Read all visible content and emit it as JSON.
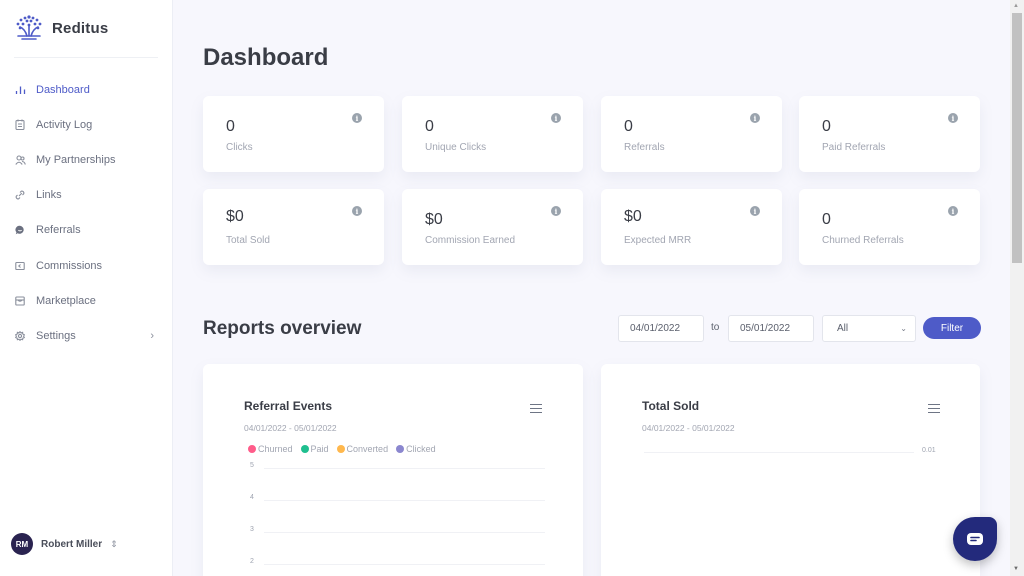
{
  "brand": {
    "name": "Reditus"
  },
  "sidebar": {
    "items": [
      {
        "label": "Dashboard",
        "icon": "bar-chart-icon",
        "active": true
      },
      {
        "label": "Activity Log",
        "icon": "clipboard-icon"
      },
      {
        "label": "My Partnerships",
        "icon": "users-icon"
      },
      {
        "label": "Links",
        "icon": "link-icon"
      },
      {
        "label": "Referrals",
        "icon": "chat-bubble-icon"
      },
      {
        "label": "Commissions",
        "icon": "wallet-icon"
      },
      {
        "label": "Marketplace",
        "icon": "store-icon"
      },
      {
        "label": "Settings",
        "icon": "gear-icon",
        "has_submenu": true
      }
    ],
    "user": {
      "initials": "RM",
      "name": "Robert Miller"
    }
  },
  "page": {
    "title": "Dashboard"
  },
  "stats": [
    {
      "value": "0",
      "label": "Clicks"
    },
    {
      "value": "0",
      "label": "Unique Clicks"
    },
    {
      "value": "0",
      "label": "Referrals"
    },
    {
      "value": "0",
      "label": "Paid Referrals"
    },
    {
      "value": "$0",
      "label": "Total Sold"
    },
    {
      "value": "$0",
      "label": "Commission Earned"
    },
    {
      "value": "$0",
      "label": "Expected MRR"
    },
    {
      "value": "0",
      "label": "Churned Referrals"
    }
  ],
  "reports": {
    "title": "Reports overview",
    "date_from": "04/01/2022",
    "to_label": "to",
    "date_to": "05/01/2022",
    "select_value": "All",
    "filter_label": "Filter"
  },
  "charts": {
    "referral_events": {
      "title": "Referral Events",
      "subtitle": "04/01/2022 - 05/01/2022",
      "legend": [
        {
          "name": "Churned",
          "color": "#ff5c8a"
        },
        {
          "name": "Paid",
          "color": "#1fbf8f"
        },
        {
          "name": "Converted",
          "color": "#ffb84d"
        },
        {
          "name": "Clicked",
          "color": "#8b87cf"
        }
      ],
      "y_ticks": [
        "5",
        "4",
        "3",
        "2"
      ]
    },
    "total_sold": {
      "title": "Total Sold",
      "subtitle": "04/01/2022 - 05/01/2022",
      "y_ticks": [
        "0.01"
      ]
    }
  },
  "colors": {
    "accent": "#4e5bc8",
    "chat": "#232a7c",
    "avatar": "#2a2350"
  }
}
